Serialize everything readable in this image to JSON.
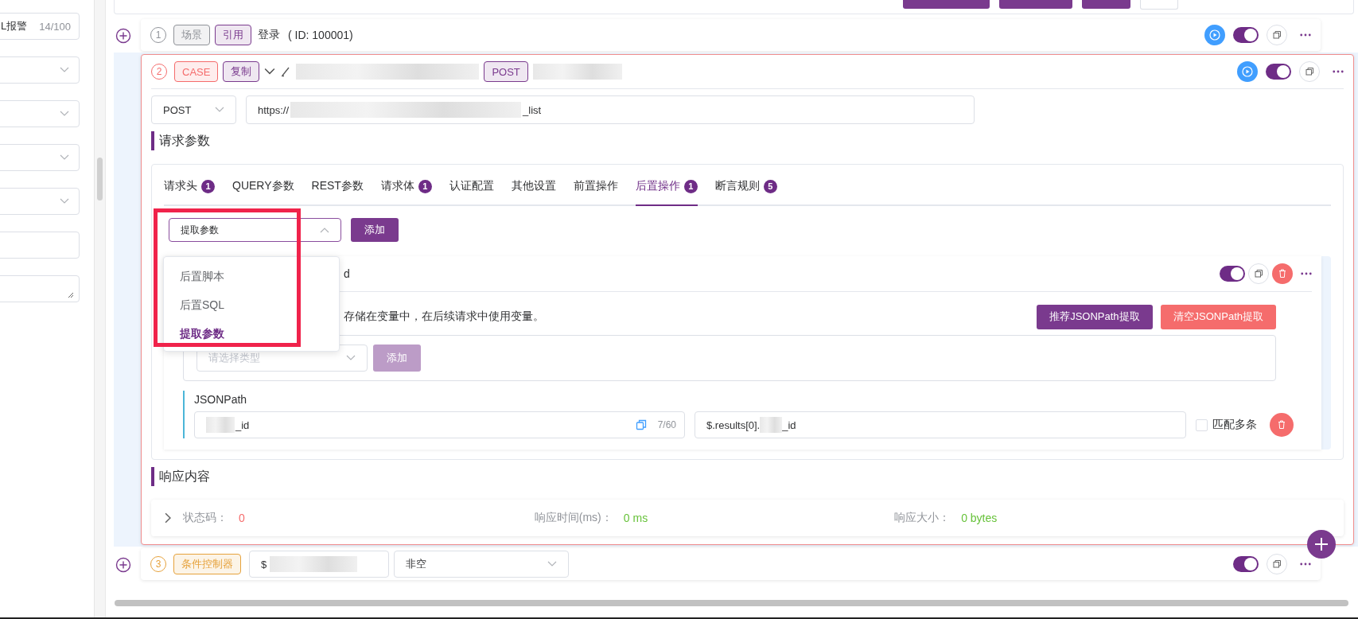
{
  "sidebar": {
    "fields": [
      {
        "kind": "input",
        "value": "L报警",
        "counter": "14/100"
      },
      {
        "kind": "select"
      },
      {
        "kind": "select"
      },
      {
        "kind": "select"
      },
      {
        "kind": "select"
      },
      {
        "kind": "input"
      },
      {
        "kind": "textarea"
      }
    ]
  },
  "steps": [
    {
      "kind": "scene",
      "selected": false,
      "number": "1",
      "tags": [
        {
          "label": "场景",
          "color": "#909399"
        },
        {
          "label": "引用",
          "color": "#7a3a8e"
        }
      ],
      "title": "登录",
      "id_text": "( ID: 100001)",
      "runnable": true,
      "enabled": true
    },
    {
      "kind": "case",
      "selected": true,
      "number": "2",
      "tags": [
        {
          "label": "CASE",
          "color": "#f56c6c"
        },
        {
          "label": "复制",
          "color": "#7a3a8e"
        }
      ],
      "method_tag": {
        "label": "POST",
        "color": "#7a3a8e"
      },
      "runnable": true,
      "enabled": true,
      "detail": {
        "method": "POST",
        "url_start": "https://",
        "url_end": "_list",
        "params_heading": "请求参数",
        "tabs": [
          {
            "label": "请求头",
            "badge": "1",
            "selected": false
          },
          {
            "label": "QUERY参数",
            "selected": false
          },
          {
            "label": "REST参数",
            "selected": false
          },
          {
            "label": "请求体",
            "badge": "1",
            "selected": false
          },
          {
            "label": "认证配置",
            "selected": false
          },
          {
            "label": "其他设置",
            "selected": false
          },
          {
            "label": "前置操作",
            "selected": false
          },
          {
            "label": "后置操作",
            "badge": "1",
            "selected": true
          },
          {
            "label": "断言规则",
            "badge": "5",
            "selected": false
          }
        ],
        "post_op": {
          "select_value": "提取参数",
          "add_button": "添加",
          "expanded": true,
          "menu": [
            {
              "label": "后置脚本",
              "selected": false
            },
            {
              "label": "后置SQL",
              "selected": false
            },
            {
              "label": "提取参数",
              "selected": true
            }
          ],
          "item": {
            "title": "d",
            "enabled": true,
            "description": "存储在变量中，在后续请求中使用变量。",
            "buttons": [
              {
                "label": "推荐JSONPath提取",
                "kind": "primary"
              },
              {
                "label": "清空JSONPath提取",
                "kind": "danger"
              }
            ],
            "type_placeholder": "请选择类型",
            "type_add": "添加",
            "section": "JSONPath",
            "name_value": "_id",
            "counter": "7/60",
            "expression_start": "$.results[0].",
            "expression_end": "_id",
            "match_label": "匹配多条",
            "match_checked": false
          }
        },
        "response_heading": "响应内容",
        "response": {
          "status_label": "状态码：",
          "status": "0",
          "time_label": "响应时间(ms)：",
          "time": "0 ms",
          "size_label": "响应大小：",
          "size": "0 bytes"
        }
      }
    },
    {
      "kind": "condition",
      "selected": false,
      "number": "3",
      "tags": [
        {
          "label": "条件控制器",
          "color": "#e6a23c"
        }
      ],
      "condition_value": "$",
      "operator": "非空",
      "runnable": false,
      "enabled": true
    }
  ]
}
